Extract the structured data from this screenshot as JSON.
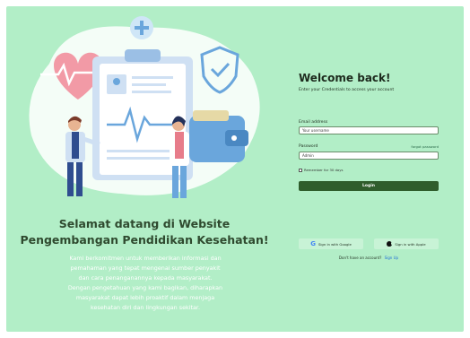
{
  "hero": {
    "title_line1": "Selamat datang di Website",
    "title_line2": "Pengembangan Pendidikan Kesehatan!",
    "description_lines": [
      "Kami berkomitmen untuk memberikan informasi dan",
      "pemahaman yang tepat mengenai sumber penyakit",
      "dan cara penanganannya kepada masyarakat.",
      "Dengan pengetahuan yang kami bagikan, diharapkan",
      "masyarakat dapat lebih proaktif dalam menjaga",
      "kesehatan diri dan lingkungan sekitar."
    ]
  },
  "form": {
    "welcome": "Welcome back!",
    "subtitle": "Enter your Credentials to access your account",
    "email_label": "Email address",
    "email_value": "Your username",
    "password_label": "Password",
    "forgot_label": "forgot password",
    "password_value": "Admin",
    "remember_label": "Remember for 30 days",
    "login_label": "Login",
    "google_label": "Sign in with Google",
    "apple_label": "Sign in with Apple",
    "no_account": "Don't have an account?",
    "signup_label": "Sign Up"
  },
  "colors": {
    "background": "#b2eec7",
    "login_button": "#2f5d2c",
    "signup_link": "#1e6dd8"
  },
  "icons": [
    "plus-icon",
    "heart-icon",
    "shield-check-icon",
    "wallet-icon",
    "clipboard-icon",
    "google-icon",
    "apple-icon"
  ]
}
